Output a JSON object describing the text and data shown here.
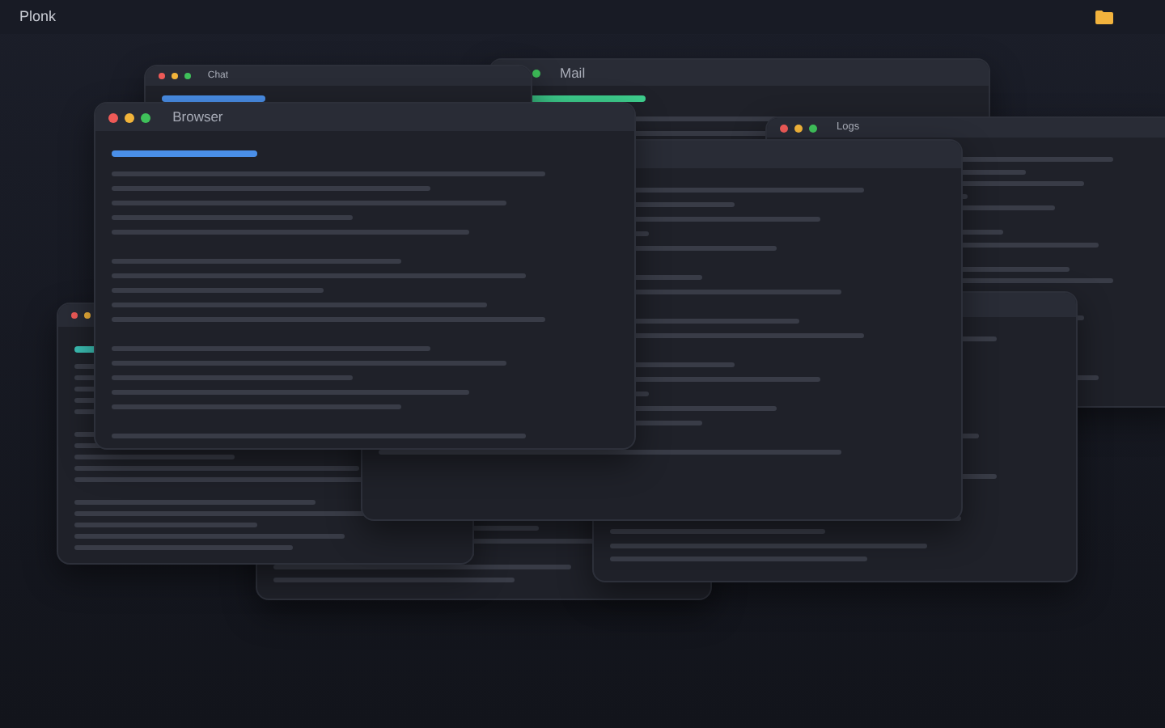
{
  "app": {
    "name": "Plonk"
  },
  "windows": [
    {
      "kind": "window",
      "title": "Mail",
      "color": "#3ecf8e"
    },
    {
      "kind": "window",
      "title": "Chat",
      "color": "#4a8fe8"
    },
    {
      "kind": "window",
      "title": "Logs"
    },
    {
      "kind": "window"
    },
    {
      "kind": "window",
      "color": "#3bbfb4"
    },
    {
      "kind": "window"
    },
    {
      "kind": "window"
    },
    {
      "kind": "window",
      "title": "Browser",
      "color": "#4a8fe8"
    }
  ]
}
